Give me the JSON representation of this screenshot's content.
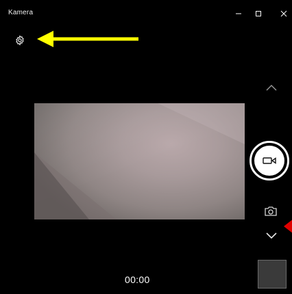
{
  "window": {
    "title": "Kamera"
  },
  "controls": {
    "settings_icon": "gear-icon",
    "chevron_up_icon": "chevron-up-icon",
    "record_icon": "video-camera-icon",
    "photo_mode_icon": "camera-icon",
    "chevron_down_icon": "chevron-down-icon"
  },
  "status": {
    "timer": "00:00"
  },
  "annotations": {
    "arrow_color": "#ffff00",
    "marker_color": "#e00000"
  }
}
